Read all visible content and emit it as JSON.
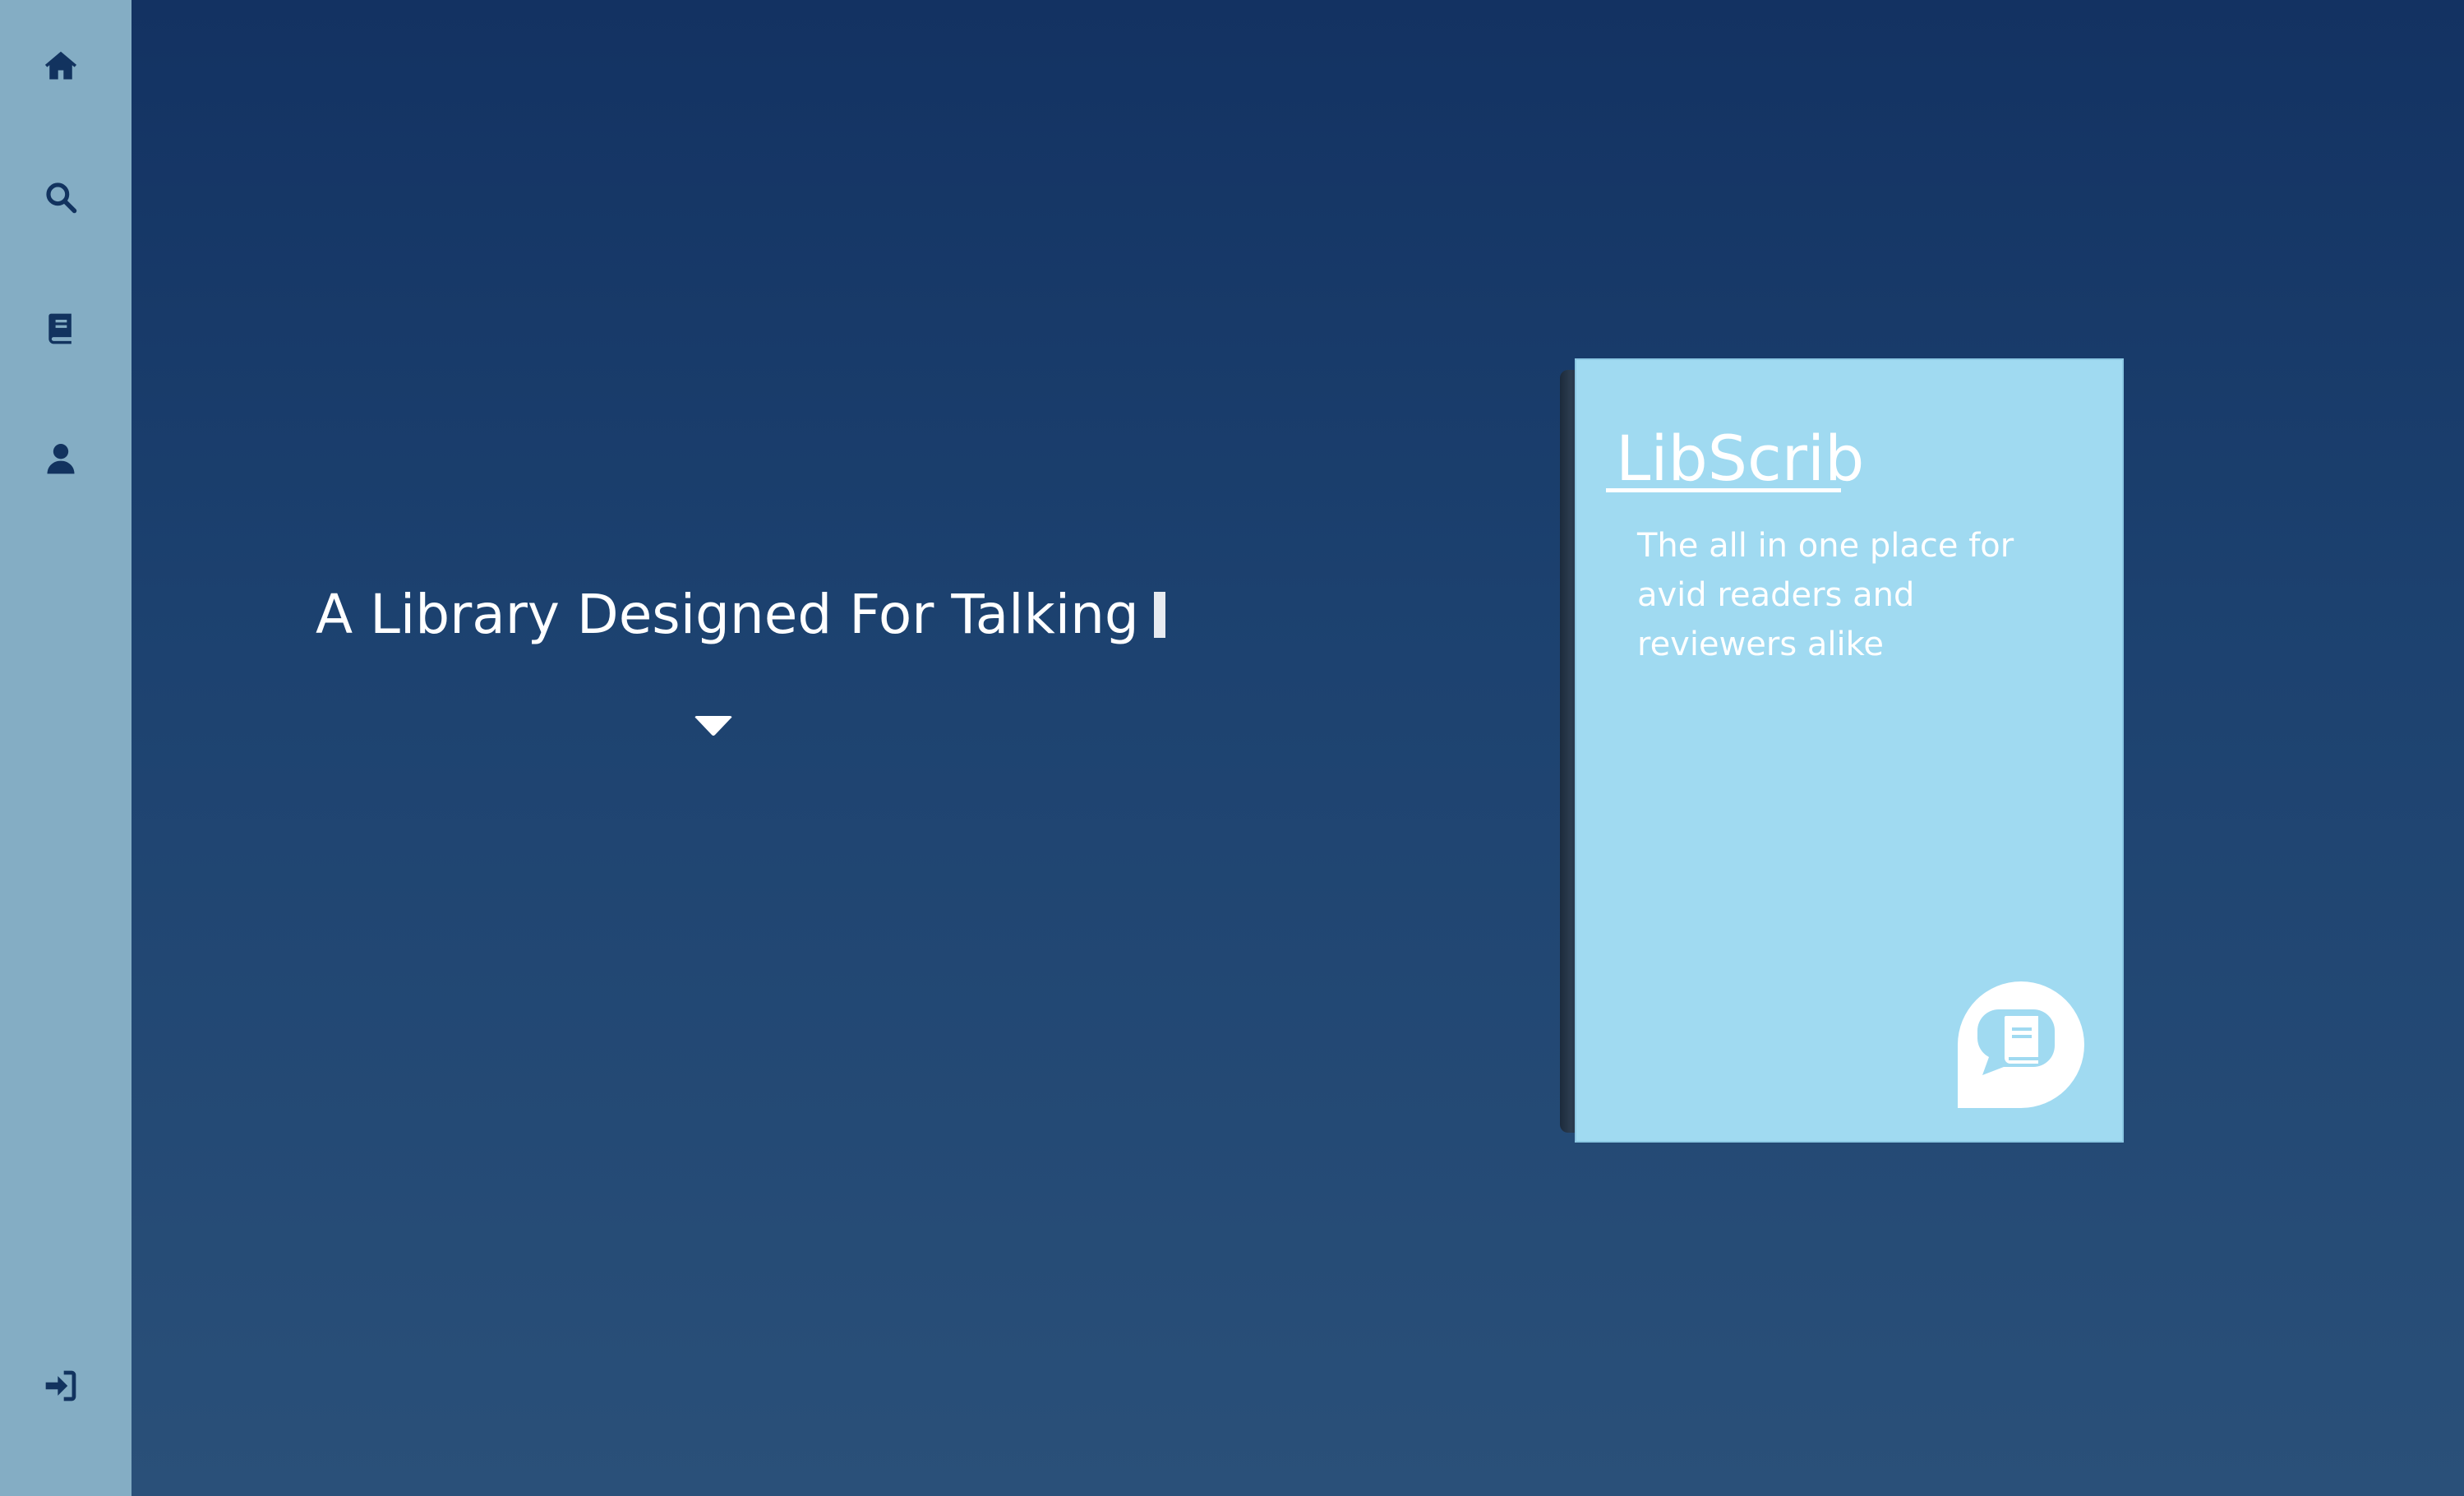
{
  "sidebar": {
    "items": [
      {
        "icon": "home-icon"
      },
      {
        "icon": "search-icon"
      },
      {
        "icon": "book-icon"
      },
      {
        "icon": "user-icon"
      }
    ],
    "bottom_item": {
      "icon": "sign-in-icon"
    }
  },
  "hero": {
    "title": "A Library Designed For Talking",
    "scroll_icon": "caret-down-icon"
  },
  "book_card": {
    "brand": "LibScrib",
    "tagline": "The all in one place for avid readers and reviewers alike",
    "logo_icon": "chat-book-icon"
  },
  "colors": {
    "sidebar": "#84adc4",
    "icon": "#12335f",
    "background_top": "#133262",
    "background_bottom": "#2a5079",
    "book_cover": "#a0daf1",
    "text": "#ffffff"
  }
}
